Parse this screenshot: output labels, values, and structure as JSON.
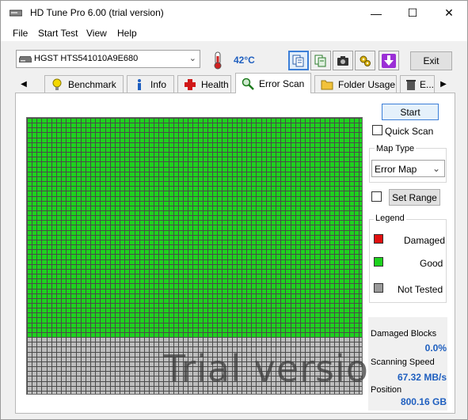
{
  "window": {
    "title": "HD Tune Pro 6.00 (trial version)",
    "minimize": "—",
    "maximize": "☐",
    "close": "✕"
  },
  "menu": [
    "File",
    "Start Test",
    "View",
    "Help"
  ],
  "toolbar": {
    "drive": "HGST HTS541010A9E680",
    "temperature": "42°C",
    "exit_label": "Exit"
  },
  "tabs": [
    {
      "label": "Benchmark",
      "icon": "lightbulb-icon"
    },
    {
      "label": "Info",
      "icon": "info-icon"
    },
    {
      "label": "Health",
      "icon": "health-cross-icon"
    },
    {
      "label": "Error Scan",
      "icon": "magnifier-icon",
      "active": true
    },
    {
      "label": "Folder Usage",
      "icon": "folder-icon"
    },
    {
      "label": "E...",
      "icon": "trash-icon"
    }
  ],
  "scan": {
    "start_label": "Start",
    "quick_scan_label": "Quick Scan",
    "quick_scan_checked": false,
    "map_type_label": "Map Type",
    "map_type_value": "Error Map",
    "set_range_label": "Set Range",
    "set_range_checked": false,
    "watermark": "Trial version"
  },
  "map": {
    "total_rows": 57,
    "total_cols": 69,
    "good_rows": 45,
    "colors": {
      "good": "#1ed21e",
      "not_tested": "#bdbdbd",
      "damaged": "#e01010",
      "grid": "#4a4a4a"
    }
  },
  "legend": {
    "title": "Legend",
    "items": [
      {
        "label": "Damaged",
        "color": "#e01010"
      },
      {
        "label": "Good",
        "color": "#1ed21e"
      },
      {
        "label": "Not Tested",
        "color": "#9a9a9a"
      }
    ]
  },
  "stats": {
    "damaged_blocks_label": "Damaged Blocks",
    "damaged_blocks_value": "0.0%",
    "scanning_speed_label": "Scanning Speed",
    "scanning_speed_value": "67.32 MB/s",
    "position_label": "Position",
    "position_value": "800.16 GB"
  }
}
